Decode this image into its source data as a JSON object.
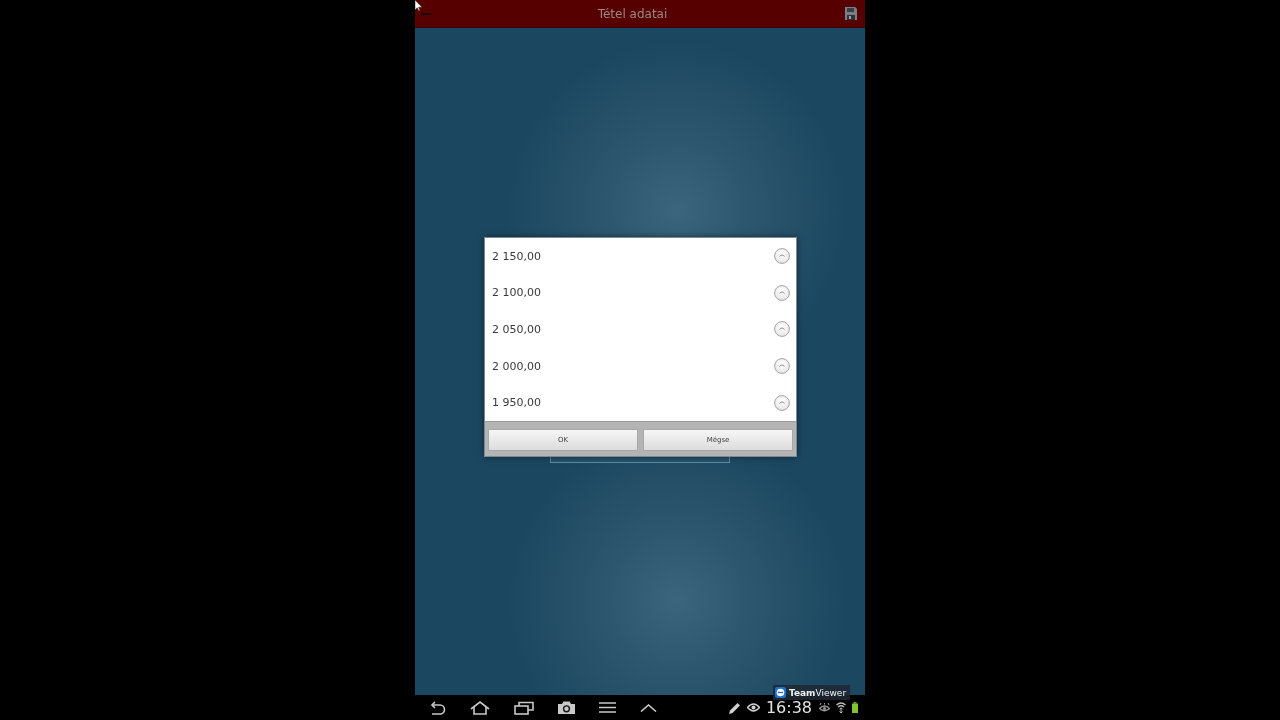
{
  "app_bar": {
    "title": "Tétel adatai"
  },
  "dialog": {
    "options": [
      {
        "label": "2 150,00",
        "selected": false
      },
      {
        "label": "2 100,00",
        "selected": false
      },
      {
        "label": "2 050,00",
        "selected": false
      },
      {
        "label": "2 000,00",
        "selected": false
      },
      {
        "label": "1 950,00",
        "selected": false
      }
    ],
    "buttons": [
      {
        "label": "OK"
      },
      {
        "label": "Mégse"
      }
    ]
  },
  "session_badge": {
    "text": "**Team**Viewer"
  },
  "navigation_bar": {
    "clock": "16:38"
  }
}
